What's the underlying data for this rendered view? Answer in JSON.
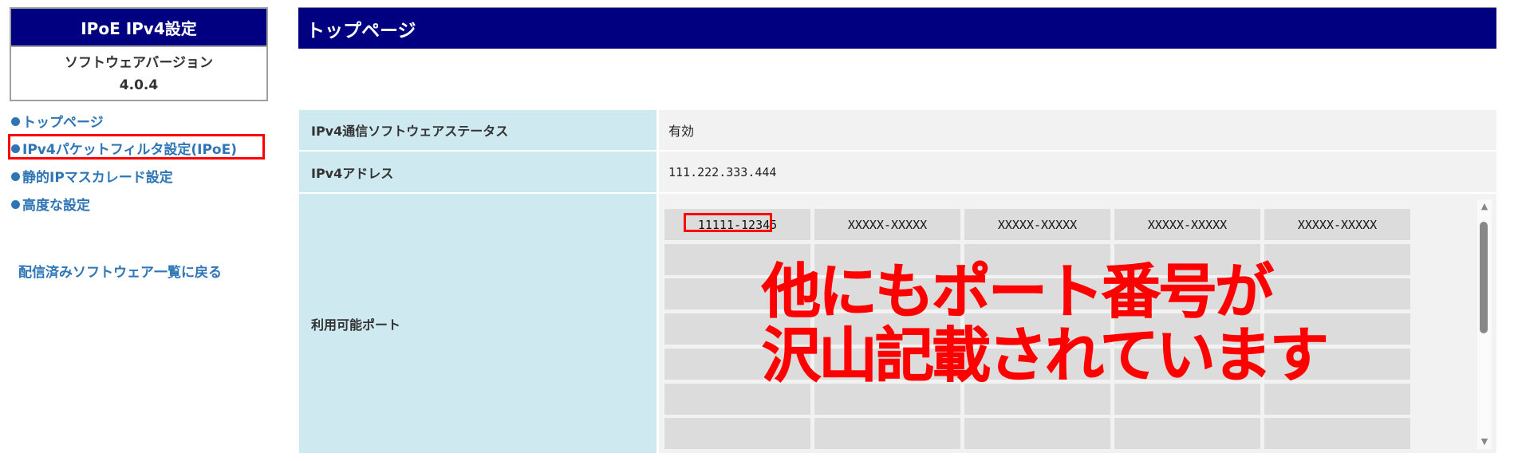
{
  "sidebar": {
    "title": "IPoE IPv4設定",
    "version_label": "ソフトウェアバージョン",
    "version": "4.0.4",
    "nav": [
      {
        "label": "トップページ"
      },
      {
        "label": "IPv4パケットフィルタ設定(IPoE)"
      },
      {
        "label": "静的IPマスカレード設定"
      },
      {
        "label": "高度な設定"
      }
    ],
    "back_link": "配信済みソフトウェア一覧に戻る"
  },
  "main": {
    "title": "トップページ",
    "rows": [
      {
        "label": "IPv4通信ソフトウェアステータス",
        "value": "有効"
      },
      {
        "label": "IPv4アドレス",
        "value": "111.222.333.444"
      },
      {
        "label": "利用可能ポート"
      }
    ],
    "ports": [
      "11111-12345",
      "XXXXX-XXXXX",
      "XXXXX-XXXXX",
      "XXXXX-XXXXX",
      "XXXXX-XXXXX"
    ]
  },
  "annotation": {
    "line1": "他にもポート番号が",
    "line2": "沢山記載されています"
  },
  "colors": {
    "navy": "#000080",
    "link": "#2e75b6",
    "highlight": "#ff0000"
  }
}
